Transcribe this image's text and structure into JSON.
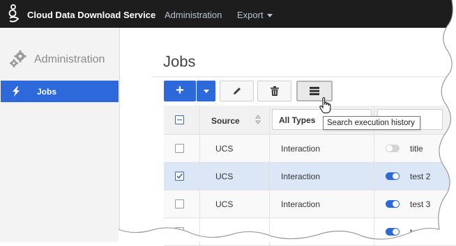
{
  "app": {
    "brand": "Cloud Data Download Service",
    "nav": {
      "administration": "Administration",
      "export": "Export"
    }
  },
  "sidebar": {
    "title": "Administration",
    "items": [
      {
        "label": "Jobs",
        "icon": "lightning-icon",
        "active": true
      }
    ]
  },
  "main": {
    "title": "Jobs",
    "toolbar": {
      "add_label": "+",
      "tooltip": "Search execution history"
    },
    "table": {
      "headers": {
        "source": "Source",
        "type_filter": "All Types"
      },
      "rows": [
        {
          "checked": false,
          "source": "UCS",
          "type": "Interaction",
          "enabled": false,
          "name": "title"
        },
        {
          "checked": true,
          "source": "UCS",
          "type": "Interaction",
          "enabled": true,
          "name": "test 2"
        },
        {
          "checked": false,
          "source": "UCS",
          "type": "Interaction",
          "enabled": true,
          "name": "test 3"
        },
        {
          "checked": false,
          "source": "",
          "type": "",
          "enabled": true,
          "name": "test"
        }
      ]
    }
  },
  "colors": {
    "accent": "#2e69db",
    "topbar": "#1d1d1d",
    "selected_row": "#dbe6f6"
  }
}
